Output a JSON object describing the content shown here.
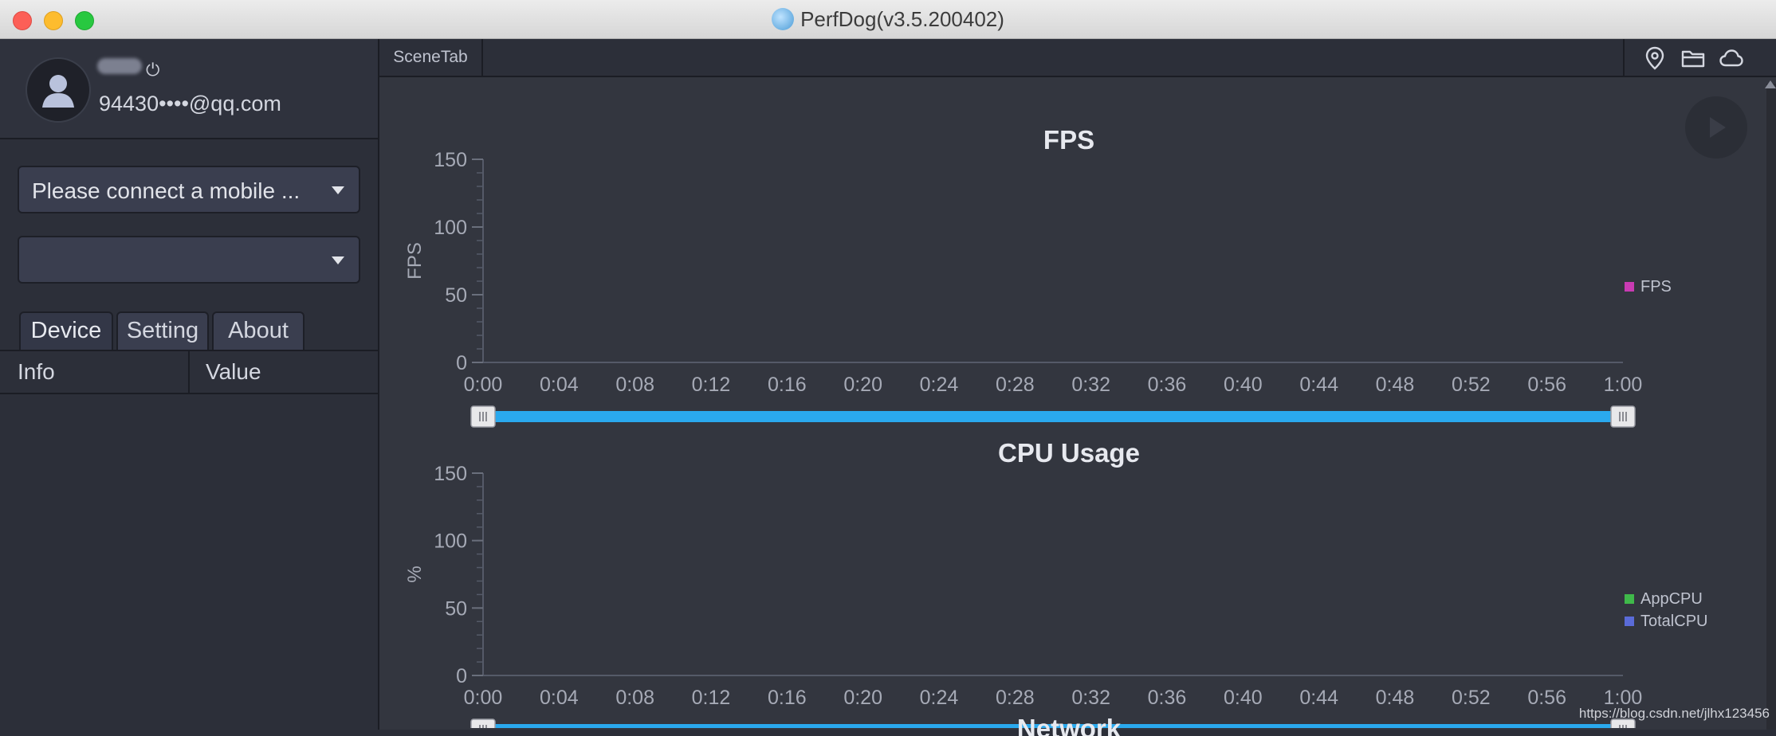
{
  "window": {
    "title": "PerfDog(v3.5.200402)"
  },
  "sidebar": {
    "email": "94430••••@qq.com",
    "device_dropdown": "Please connect a mobile ...",
    "app_dropdown": "",
    "tabs": [
      {
        "label": "Device"
      },
      {
        "label": "Setting"
      },
      {
        "label": "About"
      }
    ],
    "table_headers": {
      "info": "Info",
      "value": "Value"
    }
  },
  "main": {
    "scene_tab": "SceneTab"
  },
  "watermark": "https://blog.csdn.net/jlhx123456",
  "chart_data": [
    {
      "type": "line",
      "title": "FPS",
      "ylabel": "FPS",
      "xlabel": "",
      "ylim": [
        0,
        150
      ],
      "yticks": [
        "0",
        "50",
        "100",
        "150"
      ],
      "xticks": [
        "0:00",
        "0:04",
        "0:08",
        "0:12",
        "0:16",
        "0:20",
        "0:24",
        "0:28",
        "0:32",
        "0:36",
        "0:40",
        "0:44",
        "0:48",
        "0:52",
        "0:56",
        "1:00"
      ],
      "series": [
        {
          "name": "FPS",
          "values": [],
          "color": "#c93bb3"
        }
      ]
    },
    {
      "type": "line",
      "title": "CPU Usage",
      "ylabel": "%",
      "xlabel": "",
      "ylim": [
        0,
        150
      ],
      "yticks": [
        "0",
        "50",
        "100",
        "150"
      ],
      "xticks": [
        "0:00",
        "0:04",
        "0:08",
        "0:12",
        "0:16",
        "0:20",
        "0:24",
        "0:28",
        "0:32",
        "0:36",
        "0:40",
        "0:44",
        "0:48",
        "0:52",
        "0:56",
        "1:00"
      ],
      "series": [
        {
          "name": "AppCPU",
          "values": [],
          "color": "#3fb94a"
        },
        {
          "name": "TotalCPU",
          "values": [],
          "color": "#5a6bd8"
        }
      ]
    },
    {
      "type": "line",
      "title": "Network"
    }
  ],
  "colors": {
    "slider": "#2aa9ee",
    "accent_red": "#fc5f57",
    "accent_yellow": "#fdbc2e",
    "accent_green": "#28c840"
  }
}
